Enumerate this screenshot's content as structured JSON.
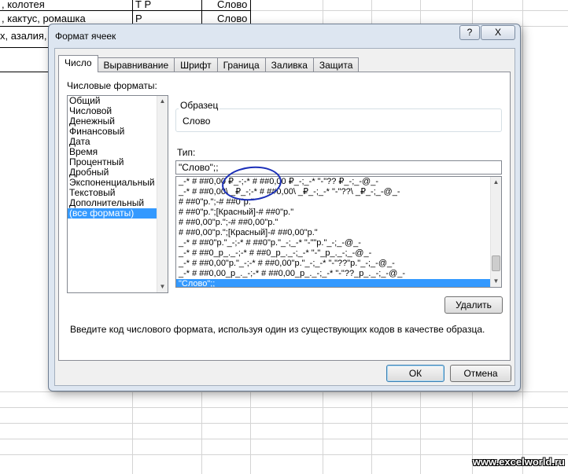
{
  "sheet": {
    "cells": [
      {
        "row": 1,
        "col": "a",
        "text": ", колотея"
      },
      {
        "row": 1,
        "col": "b",
        "text": "Т Р"
      },
      {
        "row": 1,
        "col": "c",
        "text": "Слово"
      },
      {
        "row": 2,
        "col": "a",
        "text": ", кактус, ромашка"
      },
      {
        "row": 2,
        "col": "b",
        "text": "Р"
      },
      {
        "row": 2,
        "col": "c",
        "text": "Слово"
      },
      {
        "row": 3,
        "col": "a",
        "text": "х, азалия,"
      }
    ],
    "watermark": "www.excelworld.ru"
  },
  "dialog": {
    "title": "Формат ячеек",
    "help_label": "?",
    "close_label": "X",
    "tabs": [
      "Число",
      "Выравнивание",
      "Шрифт",
      "Граница",
      "Заливка",
      "Защита"
    ],
    "active_tab": "Число",
    "categories_label": "Числовые форматы:",
    "categories": [
      "Общий",
      "Числовой",
      "Денежный",
      "Финансовый",
      "Дата",
      "Время",
      "Процентный",
      "Дробный",
      "Экспоненциальный",
      "Текстовый",
      "Дополнительный",
      "(все форматы)"
    ],
    "selected_category": "(все форматы)",
    "sample_group_label": "Образец",
    "sample_value": "Слово",
    "type_label": "Тип:",
    "type_value": "\"Слово\";;",
    "formats": [
      "_-* # ##0,00 ₽_-;-* # ##0,00 ₽_-;_-* \"-\"?? ₽_-;_-@_-",
      "_-* # ##0,00\\ _₽_-;-* # ##0,00\\ _₽_-;_-* \"-\"??\\ _₽_-;_-@_-",
      "# ##0\"р.\";-# ##0\"р.\"",
      "# ##0\"р.\";[Красный]-# ##0\"р.\"",
      "# ##0,00\"р.\";-# ##0,00\"р.\"",
      "# ##0,00\"р.\";[Красный]-# ##0,00\"р.\"",
      "_-* # ##0\"р.\"_-;-* # ##0\"р.\"_-;_-* \"-\"\"р.\"_-;_-@_-",
      "_-* # ##0_р_._-;-* # ##0_р_._-;_-* \"-\"_р_._-;_-@_-",
      "_-* # ##0,00\"р.\"_-;-* # ##0,00\"р.\"_-;_-* \"-\"??\"р.\"_-;_-@_-",
      "_-* # ##0,00_р_._-;-* # ##0,00_р_._-;_-* \"-\"??_р_._-;_-@_-",
      "\"Слово\";;"
    ],
    "selected_format": "\"Слово\";;",
    "delete_label": "Удалить",
    "hint": "Введите код числового формата, используя один из существующих кодов в качестве образца.",
    "ok_label": "ОК",
    "cancel_label": "Отмена"
  },
  "colors": {
    "selection": "#3399ff",
    "dialog_frame": "#dde6f1",
    "annotation": "#1b2fb8"
  }
}
